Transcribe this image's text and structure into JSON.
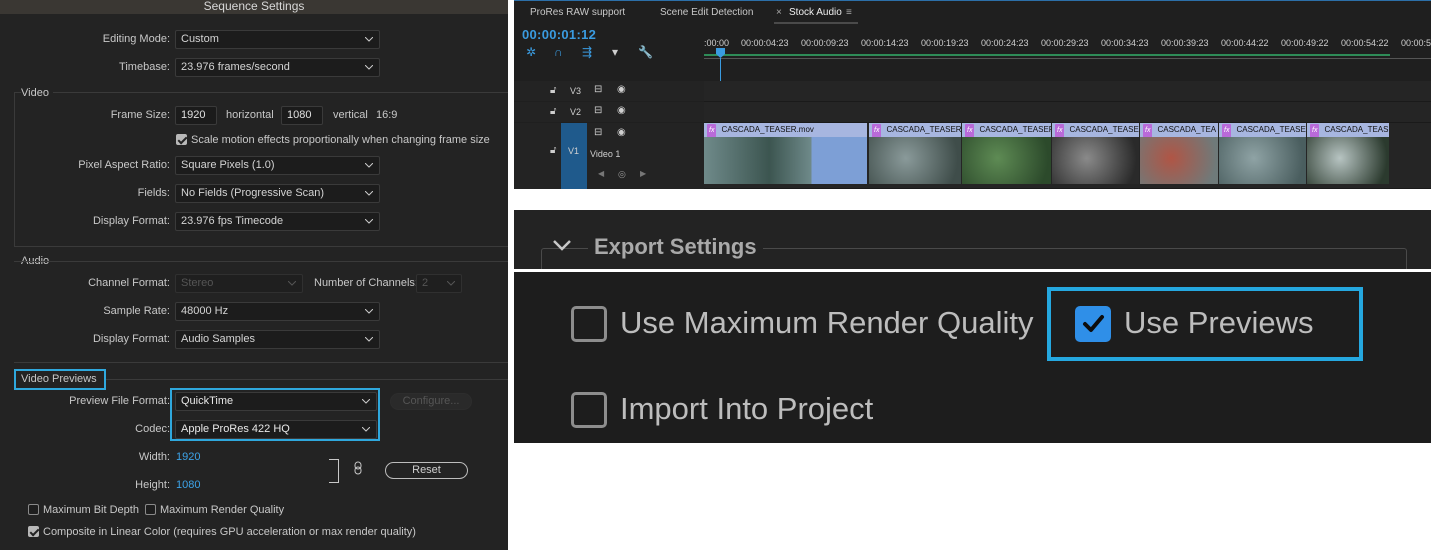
{
  "sequence_settings": {
    "title": "Sequence Settings",
    "editing_mode_label": "Editing Mode:",
    "editing_mode_value": "Custom",
    "timebase_label": "Timebase:",
    "timebase_value": "23.976  frames/second",
    "video_section": "Video",
    "frame_size_label": "Frame Size:",
    "frame_width": "1920",
    "horizontal_label": "horizontal",
    "frame_height": "1080",
    "vertical_label": "vertical",
    "aspect": "16:9",
    "scale_motion_label": "Scale motion effects proportionally when changing frame size",
    "scale_motion_checked": true,
    "pixel_aspect_label": "Pixel Aspect Ratio:",
    "pixel_aspect_value": "Square Pixels (1.0)",
    "fields_label": "Fields:",
    "fields_value": "No Fields (Progressive Scan)",
    "display_format_label": "Display Format:",
    "display_format_value": "23.976 fps Timecode",
    "audio_section": "Audio",
    "channel_format_label": "Channel Format:",
    "channel_format_value": "Stereo",
    "num_channels_label": "Number of Channels:",
    "num_channels_value": "2",
    "sample_rate_label": "Sample Rate:",
    "sample_rate_value": "48000 Hz",
    "audio_display_format_label": "Display Format:",
    "audio_display_format_value": "Audio Samples",
    "video_previews_section": "Video Previews",
    "preview_format_label": "Preview File Format:",
    "preview_format_value": "QuickTime",
    "configure_label": "Configure...",
    "codec_label": "Codec:",
    "codec_value": "Apple ProRes 422 HQ",
    "width_label": "Width:",
    "width_value": "1920",
    "height_label": "Height:",
    "height_value": "1080",
    "reset_label": "Reset",
    "max_bit_depth_label": "Maximum Bit Depth",
    "max_bit_depth_checked": false,
    "max_render_label": "Maximum Render Quality",
    "max_render_checked": false,
    "composite_label": "Composite in Linear Color (requires GPU acceleration or max render quality)",
    "composite_checked": true
  },
  "timeline": {
    "tabs": [
      {
        "label": "ProRes RAW support"
      },
      {
        "label": "Scene Edit Detection"
      },
      {
        "label": "Stock Audio"
      }
    ],
    "close_glyph": "×",
    "menu_glyph": "≡",
    "timecode": "00:00:01:12",
    "ruler_labels": [
      ":00:00",
      "00:00:04:23",
      "00:00:09:23",
      "00:00:14:23",
      "00:00:19:23",
      "00:00:24:23",
      "00:00:29:23",
      "00:00:34:23",
      "00:00:39:23",
      "00:00:44:22",
      "00:00:49:22",
      "00:00:54:22",
      "00:00:5"
    ],
    "tracks": {
      "v3": "V3",
      "v2": "V2",
      "v1": "V1",
      "video1_name": "Video 1"
    },
    "fx_badge": "fx",
    "clips": [
      {
        "name": "CASCADA_TEASER.mov",
        "color_a": "#6f8a8a",
        "color_b": "#3c5550"
      },
      {
        "name": "CASCADA_TEASER.",
        "color_a": "#8a9a9a",
        "color_b": "#3f4d4a"
      },
      {
        "name": "CASCADA_TEASER",
        "color_a": "#5e8b54",
        "color_b": "#2c4a2b"
      },
      {
        "name": "CASCADA_TEASE",
        "color_a": "#8a8a8a",
        "color_b": "#2a2a2a"
      },
      {
        "name": "CASCADA_TEA",
        "color_a": "#b05545",
        "color_b": "#6f7a7a"
      },
      {
        "name": "CASCADA_TEASER",
        "color_a": "#8fa3a5",
        "color_b": "#4a5e5f"
      },
      {
        "name": "CASCADA_TEAS",
        "color_a": "#b7c4c2",
        "color_b": "#2b3a2e"
      }
    ]
  },
  "export_settings": {
    "title": "Export Settings"
  },
  "render_options": {
    "max_render_quality_label": "Use Maximum Render Quality",
    "max_render_quality_checked": false,
    "use_previews_label": "Use Previews",
    "use_previews_checked": true,
    "import_project_label": "Import Into Project",
    "import_project_checked": false
  },
  "colors": {
    "highlight": "#2fa8dd",
    "timecode_blue": "#3a9be0",
    "checkbox_blue": "#2f8fe8"
  }
}
